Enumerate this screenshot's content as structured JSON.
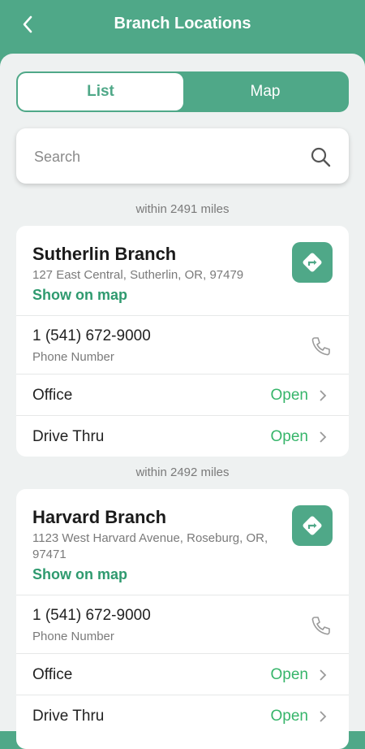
{
  "header": {
    "title": "Branch Locations"
  },
  "tabs": {
    "list": "List",
    "map": "Map",
    "active": "List"
  },
  "search": {
    "placeholder": "Search"
  },
  "colors": {
    "brand": "#4fa888",
    "open": "#36b56a",
    "link": "#2f9a6f"
  },
  "branches": [
    {
      "distance": "within 2491 miles",
      "name": "Sutherlin Branch",
      "address": "127 East Central, Sutherlin, OR, 97479",
      "show_on_map": "Show on map",
      "phone": "1 (541) 672-9000",
      "phone_label": "Phone Number",
      "office_label": "Office",
      "office_status": "Open",
      "drive_label": "Drive Thru",
      "drive_status": "Open"
    },
    {
      "distance": "within 2492 miles",
      "name": "Harvard Branch",
      "address": "1123 West Harvard Avenue, Roseburg, OR, 97471",
      "show_on_map": "Show on map",
      "phone": "1 (541) 672-9000",
      "phone_label": "Phone Number",
      "office_label": "Office",
      "office_status": "Open",
      "drive_label": "Drive Thru",
      "drive_status": "Open"
    }
  ]
}
